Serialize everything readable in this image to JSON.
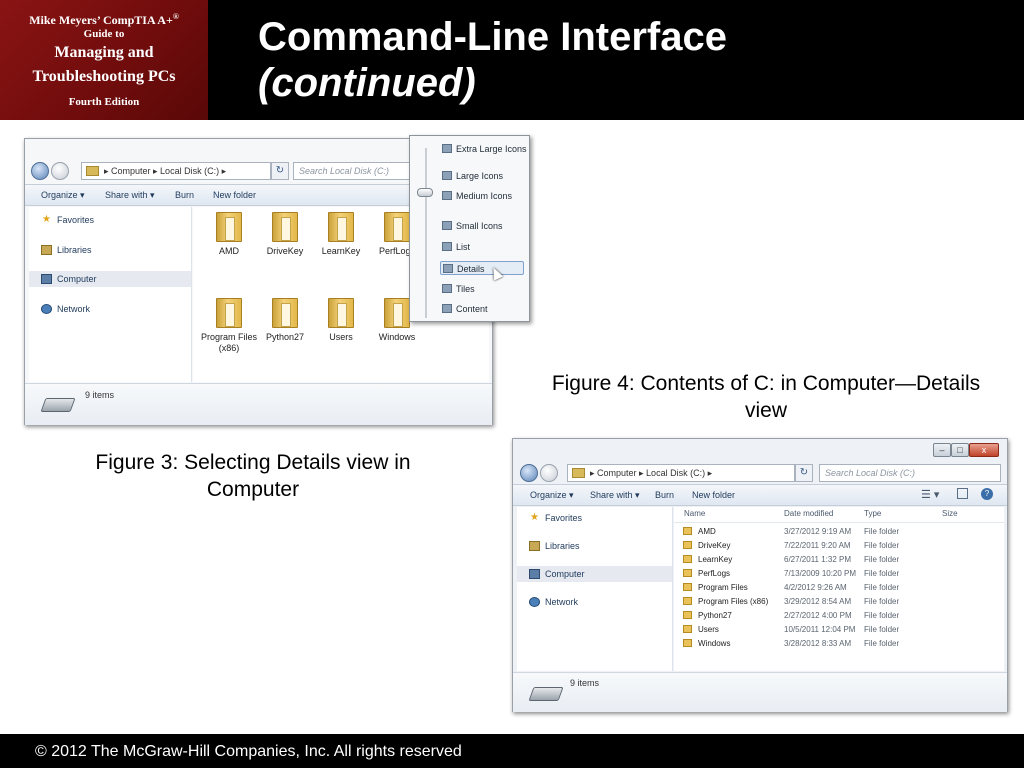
{
  "header": {
    "book_line1": "Mike Meyers’ CompTIA A+",
    "book_line1_sup": "®",
    "book_line2": "Guide to",
    "book_line3": "Managing and",
    "book_line4": "Troubleshooting PCs",
    "book_line5": "Fourth Edition",
    "title_line1": "Command-Line Interface",
    "title_line2": "(continued)"
  },
  "footer": {
    "copyright": "© 2012 The McGraw-Hill Companies, Inc. All rights reserved"
  },
  "captions": {
    "figure3": "Figure 3: Selecting Details view in Computer",
    "figure4": "Figure 4: Contents of C: in Computer—Details view"
  },
  "colors": {
    "header_bg": "#000000",
    "book_bg": "#7a0f0f",
    "footer_bg": "#000000"
  },
  "window1": {
    "address_parts": [
      "▸",
      "Computer",
      "▸",
      "Local Disk (C:)",
      "▸"
    ],
    "address_text": "▸  Computer  ▸  Local Disk (C:)  ▸",
    "search_placeholder": "Search Local Disk (C:)",
    "toolbar": {
      "organize": "Organize ▾",
      "share_with": "Share with ▾",
      "burn": "Burn",
      "new_folder": "New folder"
    },
    "nav": [
      {
        "label": "Favorites",
        "icon": "star-icon"
      },
      {
        "label": "Libraries",
        "icon": "library-icon"
      },
      {
        "label": "Computer",
        "icon": "computer-icon"
      },
      {
        "label": "Network",
        "icon": "network-icon"
      }
    ],
    "folders": [
      "AMD",
      "DriveKey",
      "LearnKey",
      "PerfLogs",
      "Program Files (x86)",
      "Python27",
      "Users",
      "Windows"
    ],
    "status": "9 items",
    "view_menu": [
      "Extra Large Icons",
      "Large Icons",
      "Medium Icons",
      "Small Icons",
      "List",
      "Details",
      "Tiles",
      "Content"
    ],
    "view_menu_selected": "Details"
  },
  "window2": {
    "address_text": "▸  Computer  ▸  Local Disk (C:)  ▸",
    "search_placeholder": "Search Local Disk (C:)",
    "toolbar": {
      "organize": "Organize ▾",
      "share_with": "Share with ▾",
      "burn": "Burn",
      "new_folder": "New folder"
    },
    "nav": [
      {
        "label": "Favorites"
      },
      {
        "label": "Libraries"
      },
      {
        "label": "Computer"
      },
      {
        "label": "Network"
      }
    ],
    "columns": [
      "Name",
      "Date modified",
      "Type",
      "Size"
    ],
    "rows": [
      {
        "name": "AMD",
        "date": "3/27/2012 9:19 AM",
        "type": "File folder"
      },
      {
        "name": "DriveKey",
        "date": "7/22/2011 9:20 AM",
        "type": "File folder"
      },
      {
        "name": "LearnKey",
        "date": "6/27/2011 1:32 PM",
        "type": "File folder"
      },
      {
        "name": "PerfLogs",
        "date": "7/13/2009 10:20 PM",
        "type": "File folder"
      },
      {
        "name": "Program Files",
        "date": "4/2/2012 9:26 AM",
        "type": "File folder"
      },
      {
        "name": "Program Files (x86)",
        "date": "3/29/2012 8:54 AM",
        "type": "File folder"
      },
      {
        "name": "Python27",
        "date": "2/27/2012 4:00 PM",
        "type": "File folder"
      },
      {
        "name": "Users",
        "date": "10/5/2011 12:04 PM",
        "type": "File folder"
      },
      {
        "name": "Windows",
        "date": "3/28/2012 8:33 AM",
        "type": "File folder"
      }
    ],
    "status": "9 items"
  }
}
